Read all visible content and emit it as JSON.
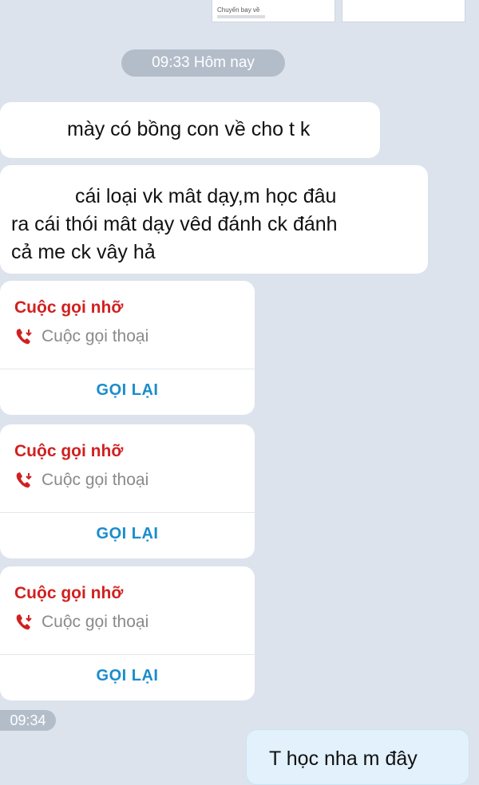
{
  "top_cards": {
    "left_title": "Chuyến bay về"
  },
  "timestamps": {
    "main": "09:33 Hôm nay",
    "second": "09:34"
  },
  "messages": [
    {
      "text": "mày có bồng con về cho t k"
    },
    {
      "lines": [
        "cái loại vk mât dạy,m học đâu",
        "ra cái thói mât dạy vêd đánh ck đánh",
        "cả me ck vây hả"
      ]
    }
  ],
  "calls": [
    {
      "title": "Cuộc gọi nhỡ",
      "type": "Cuộc gọi thoại",
      "action": "GỌI LẠI",
      "icon": "missed-call-icon"
    },
    {
      "title": "Cuộc gọi nhỡ",
      "type": "Cuộc gọi thoại",
      "action": "GỌI LẠI",
      "icon": "missed-call-icon"
    },
    {
      "title": "Cuộc gọi nhỡ",
      "type": "Cuộc gọi thoại",
      "action": "GỌI LẠI",
      "icon": "missed-call-icon"
    }
  ],
  "outgoing": {
    "text": "T học nha m đây"
  },
  "colors": {
    "background": "#dde3ec",
    "missed": "#d12020",
    "action": "#1a8ccc",
    "outgoing_bubble": "#e2f1fb"
  }
}
